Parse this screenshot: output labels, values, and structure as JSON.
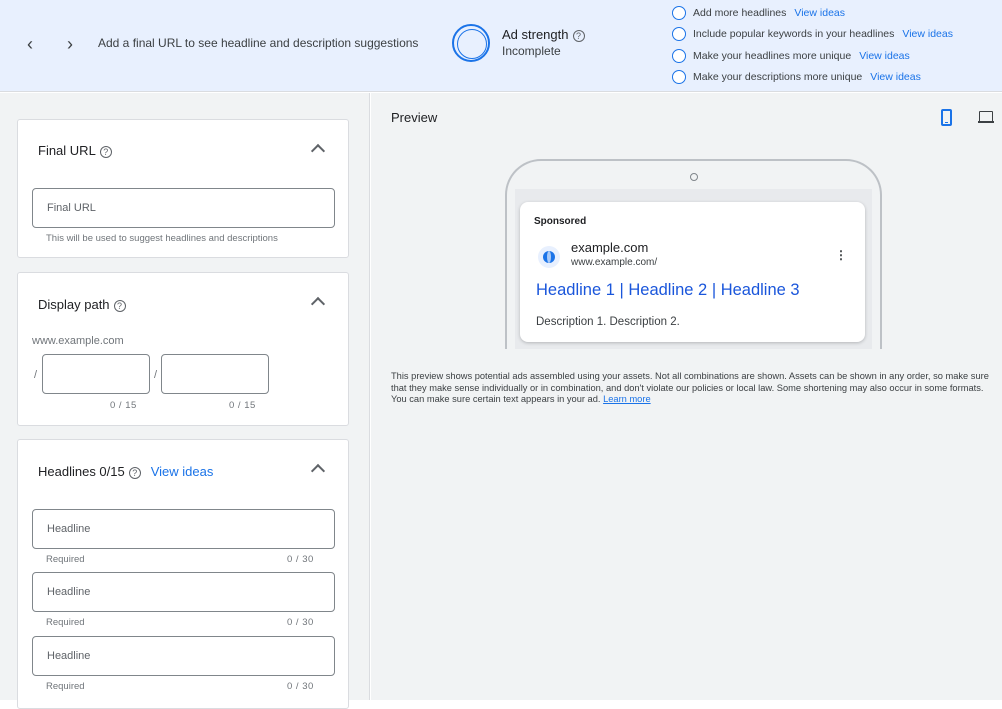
{
  "topbar": {
    "back_arrow": "‹",
    "forward_arrow": "›",
    "suggest_text": "Add a final URL to see headline and description suggestions",
    "ad_strength_label": "Ad strength",
    "ad_strength_status": "Incomplete",
    "help_glyph": "?",
    "tips": [
      {
        "text": "Add more headlines",
        "link": "View ideas"
      },
      {
        "text": "Include popular keywords in your headlines",
        "link": "View ideas"
      },
      {
        "text": "Make your headlines more unique",
        "link": "View ideas"
      },
      {
        "text": "Make your descriptions more unique",
        "link": "View ideas"
      }
    ]
  },
  "final_url": {
    "title": "Final URL",
    "placeholder": "Final URL",
    "hint": "This will be used to suggest headlines and descriptions"
  },
  "display_path": {
    "title": "Display path",
    "domain": "www.example.com",
    "separator": "/",
    "counter1": "0 / 15",
    "counter2": "0 / 15"
  },
  "headlines": {
    "title": "Headlines 0/15",
    "view_ideas": "View ideas",
    "fields": [
      {
        "placeholder": "Headline",
        "hint": "Required",
        "counter": "0 / 30"
      },
      {
        "placeholder": "Headline",
        "hint": "Required",
        "counter": "0 / 30"
      },
      {
        "placeholder": "Headline",
        "hint": "Required",
        "counter": "0 / 30"
      }
    ]
  },
  "preview": {
    "title": "Preview",
    "sponsored": "Sponsored",
    "domain": "example.com",
    "url": "www.example.com/",
    "kebab": "⋮",
    "headline": "Headline 1 | Headline 2 | Headline 3",
    "description": "Description 1. Description 2.",
    "disclaimer": "This preview shows potential ads assembled using your assets. Not all combinations are shown. Assets can be shown in any order, so make sure that they make sense individually or in combination, and don't violate our policies or local law. Some shortening may also occur in some formats. You can make sure certain text appears in your ad.",
    "learn_more": "Learn more"
  },
  "colors": {
    "accent": "#1a73e8",
    "topbar_bg": "#e8f0fe",
    "pane_bg": "#f1f3f4"
  }
}
